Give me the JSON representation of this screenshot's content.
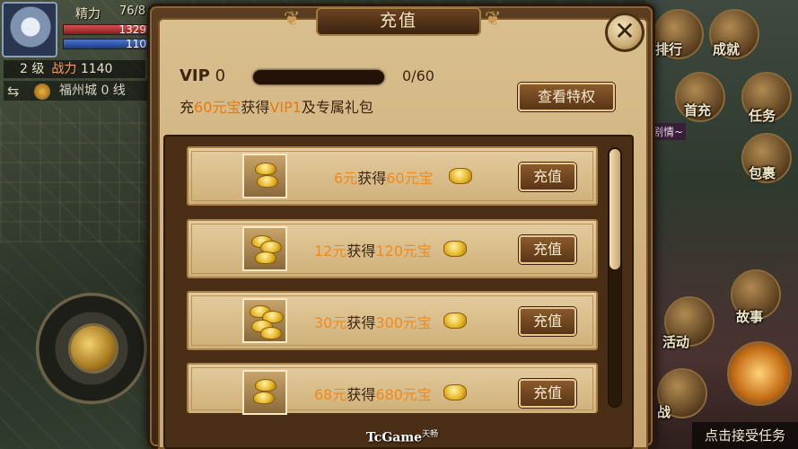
{
  "hud": {
    "name": "精力",
    "energy": "76/8",
    "hp": "1329",
    "mp": "110",
    "level": "2 级",
    "power_label": "战力",
    "power": "1140",
    "map": "福州城 0 线"
  },
  "dialog": {
    "title": "充值",
    "close_label": "✕",
    "vip_prefix": "VIP",
    "vip_level": "0",
    "vip_progress": 0,
    "vip_progress_text": "0/60",
    "vip_desc_1": "充",
    "vip_desc_amount": "60元宝",
    "vip_desc_2": "获得",
    "vip_desc_vip": "VIP1",
    "vip_desc_3": "及专属礼包",
    "privilege_button": "查看特权"
  },
  "packages": [
    {
      "price": "6元",
      "mid": "获得",
      "amount": "60元宝",
      "button": "充值"
    },
    {
      "price": "12元",
      "mid": "获得",
      "amount": "120元宝",
      "button": "充值"
    },
    {
      "price": "30元",
      "mid": "获得",
      "amount": "300元宝",
      "button": "充值"
    },
    {
      "price": "68元",
      "mid": "获得",
      "amount": "680元宝",
      "button": "充值"
    }
  ],
  "side_menu": {
    "ranking": "排行",
    "achievement": "成就",
    "first_charge": "首充",
    "quest": "任务",
    "bag": "包裹",
    "story": "故事",
    "activity": "活动",
    "battle": "战",
    "quest_tag": "剧情~"
  },
  "bottom_tip": "点击接受任务",
  "watermark": {
    "brand": "TcGame",
    "cn": "天畅"
  },
  "colors": {
    "highlight": "#f08a1c",
    "panel": "#d9bf8e",
    "frame": "#5b3d21"
  }
}
